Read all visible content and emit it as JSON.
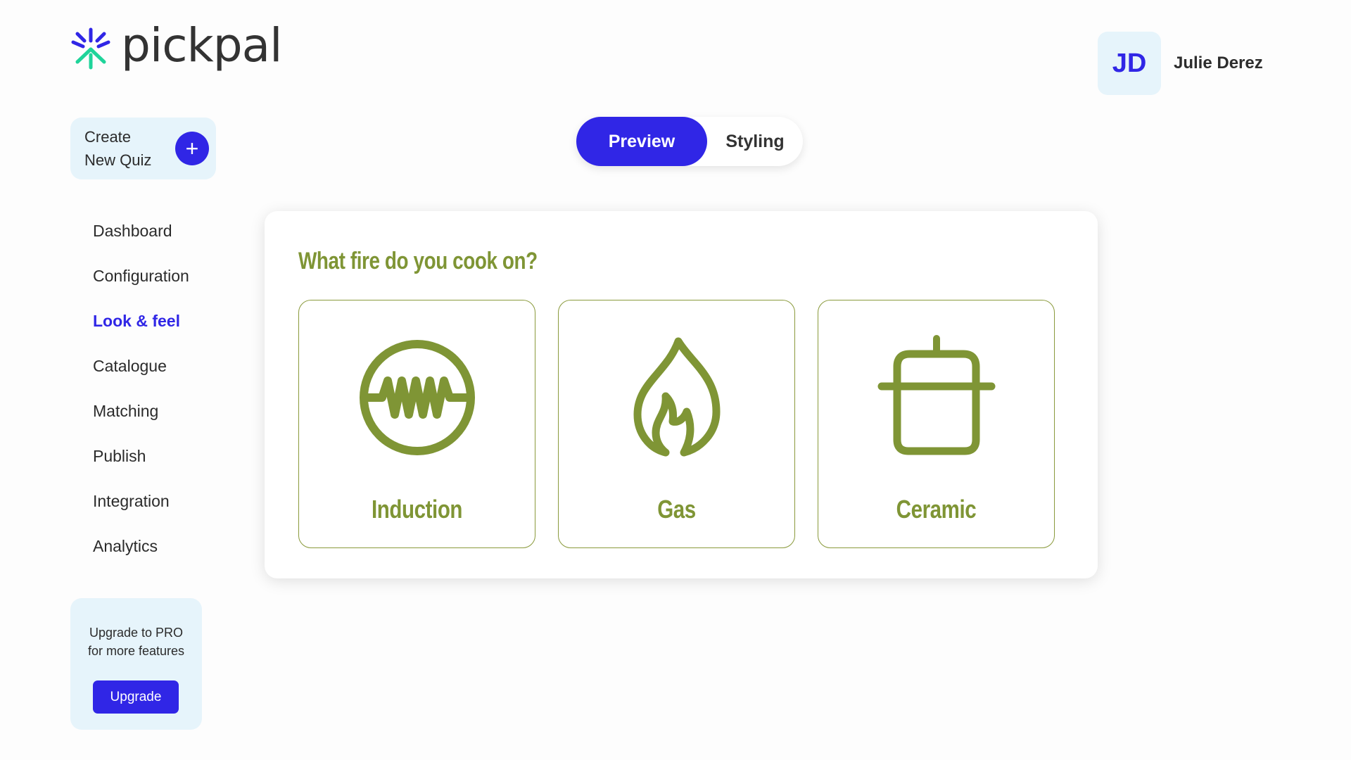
{
  "brand": {
    "name": "pickpal"
  },
  "user": {
    "initials": "JD",
    "name": "Julie Derez"
  },
  "create_quiz": {
    "label_line1": "Create",
    "label_line2": "New Quiz",
    "plus": "+"
  },
  "nav": {
    "items": [
      {
        "label": "Dashboard",
        "active": false
      },
      {
        "label": "Configuration",
        "active": false
      },
      {
        "label": "Look & feel",
        "active": true
      },
      {
        "label": "Catalogue",
        "active": false
      },
      {
        "label": "Matching",
        "active": false
      },
      {
        "label": "Publish",
        "active": false
      },
      {
        "label": "Integration",
        "active": false
      },
      {
        "label": "Analytics",
        "active": false
      }
    ]
  },
  "upgrade": {
    "text_line1": "Upgrade to PRO",
    "text_line2": "for more features",
    "button": "Upgrade"
  },
  "toggle": {
    "preview": "Preview",
    "styling": "Styling",
    "selected": "Preview"
  },
  "quiz": {
    "question": "What fire do you cook on?",
    "options": [
      {
        "label": "Induction",
        "icon": "induction-icon"
      },
      {
        "label": "Gas",
        "icon": "flame-icon"
      },
      {
        "label": "Ceramic",
        "icon": "pot-icon"
      }
    ]
  },
  "colors": {
    "accent": "#3026e6",
    "quiz_green": "#7f9535",
    "panel_bg": "#e6f4fb"
  }
}
